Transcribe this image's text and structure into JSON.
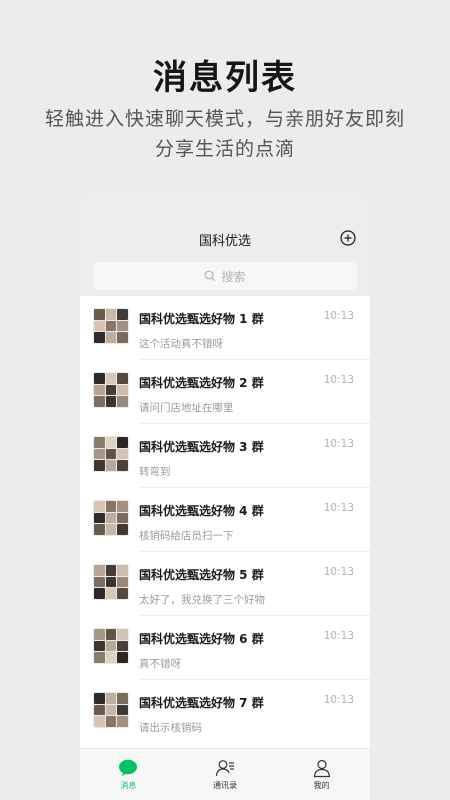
{
  "promo": {
    "title": "消息列表",
    "subtitle": "轻触进入快速聊天模式，与亲朋好友即刻分享生活的点滴"
  },
  "app": {
    "title": "国科优选",
    "add_icon": "plus-circle-icon",
    "search_placeholder": "搜索"
  },
  "chats": [
    {
      "name": "国科优选甄选好物 1 群",
      "preview": "这个活动真不错呀",
      "time": "10:13"
    },
    {
      "name": "国科优选甄选好物 2 群",
      "preview": "请问门店地址在哪里",
      "time": "10:13"
    },
    {
      "name": "国科优选甄选好物 3 群",
      "preview": "转弯到",
      "time": "10:13"
    },
    {
      "name": "国科优选甄选好物 4 群",
      "preview": "核销码给店员扫一下",
      "time": "10:13"
    },
    {
      "name": "国科优选甄选好物 5 群",
      "preview": "太好了，我兑换了三个好物",
      "time": "10:13"
    },
    {
      "name": "国科优选甄选好物 6 群",
      "preview": "真不错呀",
      "time": "10:13"
    },
    {
      "name": "国科优选甄选好物 7 群",
      "preview": "请出示核销码",
      "time": "10:13"
    }
  ],
  "tabs": [
    {
      "label": "消息",
      "icon": "chat-bubble-icon",
      "active": true
    },
    {
      "label": "通讯录",
      "icon": "contacts-icon",
      "active": false
    },
    {
      "label": "我的",
      "icon": "person-icon",
      "active": false
    }
  ],
  "colors": {
    "accent": "#07c160",
    "background": "#ececec",
    "header": "#ededed"
  }
}
